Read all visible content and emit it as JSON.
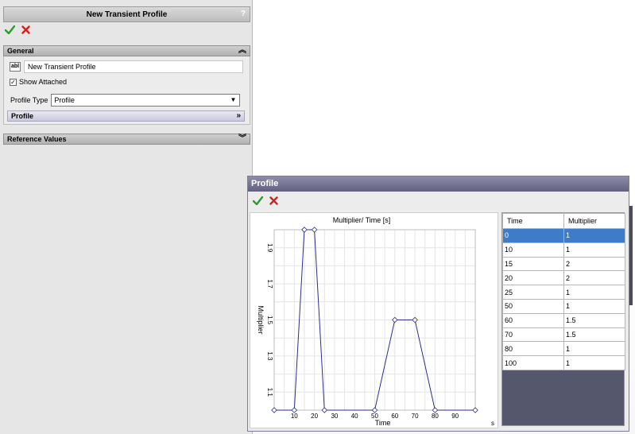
{
  "panel": {
    "title": "New Transient Profile",
    "help": "?",
    "general": {
      "header": "General",
      "name_value": "New Transient Profile",
      "name_icon_text": "abl",
      "show_attached_label": "Show Attached",
      "show_attached_checked": "✓",
      "profile_type_label": "Profile Type",
      "profile_type_value": "Profile",
      "profile_subsection_label": "Profile"
    },
    "reference_values_header": "Reference Values"
  },
  "dialog": {
    "title": "Profile",
    "table": {
      "headers": [
        "Time",
        "Multiplier"
      ],
      "rows": [
        [
          "0",
          "1"
        ],
        [
          "10",
          "1"
        ],
        [
          "15",
          "2"
        ],
        [
          "20",
          "2"
        ],
        [
          "25",
          "1"
        ],
        [
          "50",
          "1"
        ],
        [
          "60",
          "1.5"
        ],
        [
          "70",
          "1.5"
        ],
        [
          "80",
          "1"
        ],
        [
          "100",
          "1"
        ]
      ],
      "selected_row": 0
    }
  },
  "colors": {
    "line": "#2b2f8f",
    "grid": "#e4e4e4",
    "accept": "#2f9a2f",
    "cancel": "#d41f1f",
    "selected_row": "#3e7bc9"
  },
  "chart_data": {
    "type": "line",
    "title": "Multiplier/ Time [s]",
    "xlabel": "Time",
    "ylabel": "Multiplier",
    "x_unit": "s",
    "xlim": [
      0,
      100
    ],
    "ylim": [
      1,
      2
    ],
    "xticks": [
      10,
      20,
      30,
      40,
      50,
      60,
      70,
      80,
      90
    ],
    "yticks": [
      1.1,
      1.3,
      1.5,
      1.7,
      1.9
    ],
    "grid": true,
    "x": [
      0,
      10,
      15,
      20,
      25,
      50,
      60,
      70,
      80,
      100
    ],
    "series": [
      {
        "values": [
          1,
          1,
          2,
          2,
          1,
          1,
          1.5,
          1.5,
          1,
          1
        ]
      }
    ]
  }
}
